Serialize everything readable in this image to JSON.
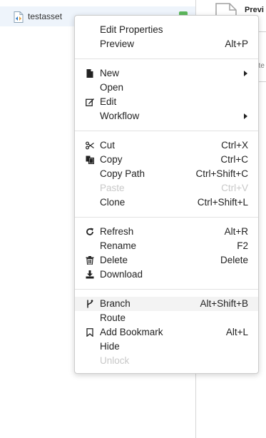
{
  "tree": {
    "asset_label": "testasset"
  },
  "preview_panel": {
    "title": "Previ",
    "sub1": "ote",
    "sub2": "ote"
  },
  "menu": {
    "edit_properties": {
      "label": "Edit Properties",
      "shortcut": ""
    },
    "preview": {
      "label": "Preview",
      "shortcut": "Alt+P"
    },
    "new": {
      "label": "New"
    },
    "open": {
      "label": "Open"
    },
    "edit": {
      "label": "Edit"
    },
    "workflow": {
      "label": "Workflow"
    },
    "cut": {
      "label": "Cut",
      "shortcut": "Ctrl+X"
    },
    "copy": {
      "label": "Copy",
      "shortcut": "Ctrl+C"
    },
    "copy_path": {
      "label": "Copy Path",
      "shortcut": "Ctrl+Shift+C"
    },
    "paste": {
      "label": "Paste",
      "shortcut": "Ctrl+V"
    },
    "clone": {
      "label": "Clone",
      "shortcut": "Ctrl+Shift+L"
    },
    "refresh": {
      "label": "Refresh",
      "shortcut": "Alt+R"
    },
    "rename": {
      "label": "Rename",
      "shortcut": "F2"
    },
    "delete": {
      "label": "Delete",
      "shortcut": "Delete"
    },
    "download": {
      "label": "Download"
    },
    "branch": {
      "label": "Branch",
      "shortcut": "Alt+Shift+B"
    },
    "route": {
      "label": "Route"
    },
    "add_bookmark": {
      "label": "Add Bookmark",
      "shortcut": "Alt+L"
    },
    "hide": {
      "label": "Hide"
    },
    "unlock": {
      "label": "Unlock"
    }
  },
  "colors": {
    "selected_row_bg": "#eef4fb",
    "hover_bg": "#f3f3f3",
    "disabled_text": "#c8c8c8",
    "status_green": "#5cb85c"
  }
}
